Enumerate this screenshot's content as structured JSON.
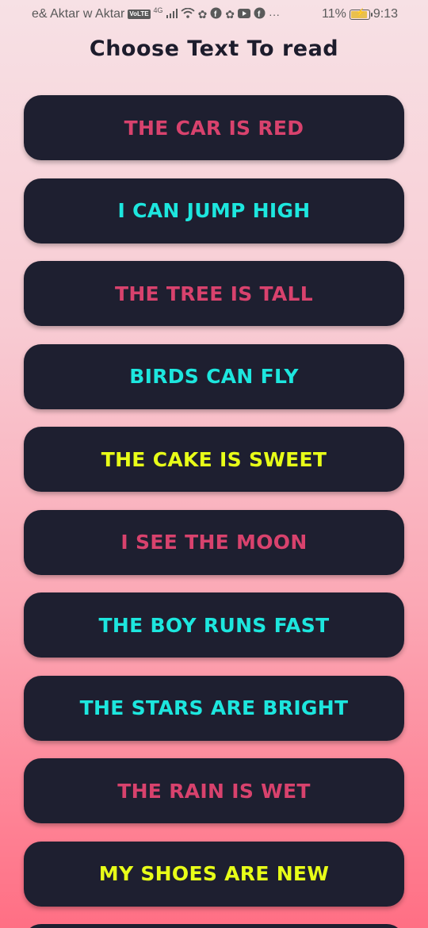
{
  "status_bar": {
    "carrier": "e& Aktar w Aktar",
    "volte": "VoLTE",
    "network": "4G",
    "battery": "11%",
    "time": "9:13",
    "icons": [
      "signal-icon",
      "wifi-icon",
      "huawei-app-icon",
      "facebook-icon",
      "huawei-app-icon",
      "youtube-icon",
      "facebook-icon",
      "more-icon"
    ]
  },
  "title": "Choose Text To read",
  "colors": {
    "pink": "#d8426d",
    "cyan": "#1de6de",
    "yellow": "#e8ff18",
    "button_bg": "#1e1f30"
  },
  "items": [
    {
      "label": "THE CAR IS RED",
      "color": "#d8426d"
    },
    {
      "label": "I CAN JUMP HIGH",
      "color": "#1de6de"
    },
    {
      "label": "THE TREE IS TALL",
      "color": "#d8426d"
    },
    {
      "label": "BIRDS CAN FLY",
      "color": "#1de6de"
    },
    {
      "label": "THE CAKE IS SWEET",
      "color": "#e8ff18"
    },
    {
      "label": "I SEE THE MOON",
      "color": "#d8426d"
    },
    {
      "label": "THE BOY RUNS FAST",
      "color": "#1de6de"
    },
    {
      "label": "THE STARS ARE BRIGHT",
      "color": "#1de6de"
    },
    {
      "label": "THE RAIN IS WET",
      "color": "#d8426d"
    },
    {
      "label": "MY SHOES ARE NEW",
      "color": "#e8ff18"
    }
  ]
}
